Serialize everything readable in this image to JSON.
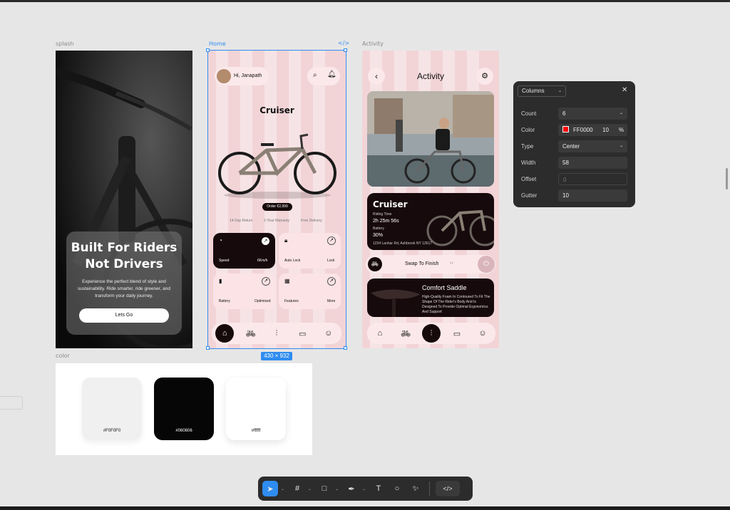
{
  "frames": {
    "splash_label": "splash",
    "home_label": "Home",
    "activity_label": "Activity",
    "color_label": "color",
    "size_badge": "430 × 932"
  },
  "splash": {
    "title_line1": "Built For Riders",
    "title_line2": "Not Drivers",
    "description": "Experience the perfect blend of style and sustainability. Ride smarter, ride greener, and transform your daily journey.",
    "button_label": "Lets Go"
  },
  "home": {
    "greeting": "Hi, Janapath",
    "product_name": "Cruiser",
    "price_badge": "Order €2,999",
    "perks": [
      "14-Day Return",
      "2-Year Warranty",
      "Free Delivery"
    ],
    "cards": [
      {
        "label": "Speed",
        "value": "6Km/h"
      },
      {
        "label": "Auto Lock",
        "value": "Lock"
      },
      {
        "label": "Battery",
        "value": "Optimised"
      },
      {
        "label": "Features",
        "value": "More"
      }
    ]
  },
  "activity": {
    "title": "Activity",
    "card_title": "Cruiser",
    "riding_time_label": "Riding Time",
    "riding_time": "2h 25m 56s",
    "battery_label": "Battery",
    "battery_value": "30%",
    "location": "1234 Lanhar Rd, Ashbrook NY 12617",
    "swap_label": "Swap To Finish",
    "saddle_title": "Comfort Saddle",
    "saddle_desc": "High-Quality Foam In Contoured To Fit The Shape Of The Rider's Body And Is Designed To Provide Optimal Ergonomics And Support"
  },
  "colors": [
    {
      "hex": "#F0F0F0",
      "label": "#F0F0F0"
    },
    {
      "hex": "#060606",
      "label": "#060606"
    },
    {
      "hex": "#ffffff",
      "label": "#ffffff"
    }
  ],
  "panel": {
    "dropdown": "Columns",
    "count_label": "Count",
    "count_value": "6",
    "color_label": "Color",
    "color_hex": "FF0000",
    "color_opacity": "10",
    "percent": "%",
    "type_label": "Type",
    "type_value": "Center",
    "width_label": "Width",
    "width_value": "58",
    "offset_label": "Offset",
    "offset_value": "0",
    "gutter_label": "Gutter",
    "gutter_value": "10"
  },
  "toolbar": {
    "icons": [
      "move-icon",
      "frame-icon",
      "shape-icon",
      "pen-icon",
      "text-icon",
      "comment-icon",
      "actions-icon",
      "dev-mode-icon"
    ]
  },
  "accent": "#2f8cf0"
}
